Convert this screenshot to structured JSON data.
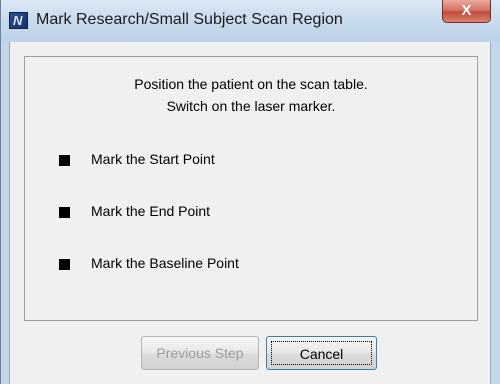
{
  "window": {
    "title": "Mark Research/Small Subject Scan Region",
    "icon": "N",
    "close_label": "X"
  },
  "instructions": {
    "line1": "Position the patient on the scan table.",
    "line2": "Switch on the laser marker."
  },
  "steps": [
    {
      "label": "Mark the Start Point"
    },
    {
      "label": "Mark the End Point"
    },
    {
      "label": "Mark the Baseline Point"
    }
  ],
  "buttons": {
    "previous": "Previous Step",
    "cancel": "Cancel"
  }
}
